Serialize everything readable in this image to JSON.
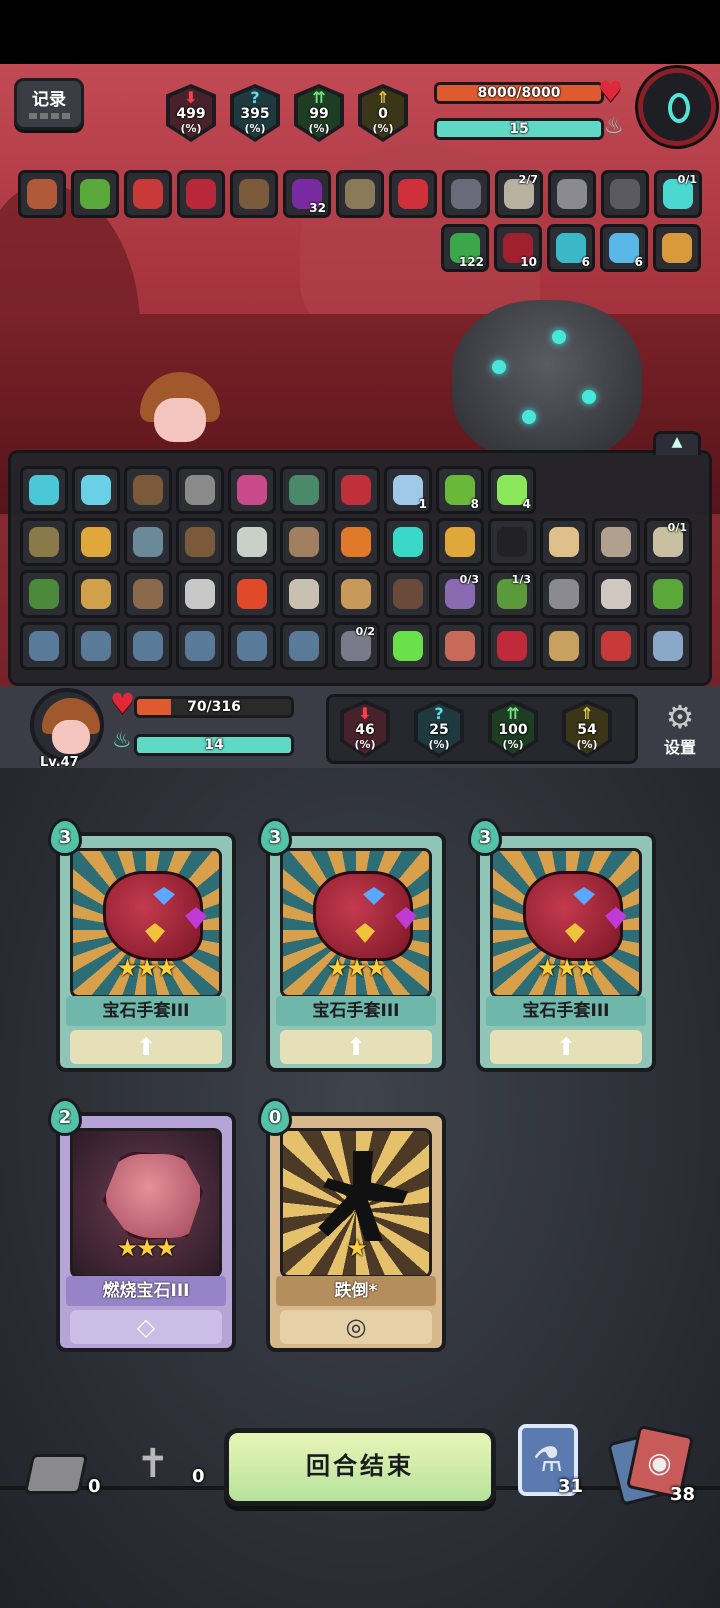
{
  "enemy": {
    "stats": [
      {
        "name": "attack",
        "value": "499",
        "unit": "(%)",
        "glyph": "⬇",
        "color": "red"
      },
      {
        "name": "mystery",
        "value": "395",
        "unit": "(%)",
        "glyph": "?",
        "color": "cyan"
      },
      {
        "name": "defense",
        "value": "99",
        "unit": "(%)",
        "glyph": "⇈",
        "color": "green"
      },
      {
        "name": "crit",
        "value": "0",
        "unit": "(%)",
        "glyph": "⇑",
        "color": "gold"
      }
    ],
    "hp_text": "8000/8000",
    "hp_fraction": 1.0,
    "energy_text": "15",
    "energy_fraction": 1.0,
    "relics_row1": [
      {
        "icon": "meat-icon",
        "count": "",
        "frac": "",
        "color": "#b05a3a"
      },
      {
        "icon": "green-slime-icon",
        "count": "",
        "frac": "",
        "color": "#5aa83a"
      },
      {
        "icon": "red-flute-icon",
        "count": "",
        "frac": "",
        "color": "#c83a3a"
      },
      {
        "icon": "boxing-glove-icon",
        "count": "",
        "frac": "",
        "color": "#b8283a"
      },
      {
        "icon": "owl-icon",
        "count": "",
        "frac": "",
        "color": "#7a5a3a"
      },
      {
        "icon": "attack-down-icon",
        "count": "32",
        "frac": "",
        "color": "#7a2aa0"
      },
      {
        "icon": "book-icon",
        "count": "",
        "frac": "",
        "color": "#8a7a5a"
      },
      {
        "icon": "red-bottle-icon",
        "count": "",
        "frac": "",
        "color": "#d0303a"
      },
      {
        "icon": "arrows-icon",
        "count": "",
        "frac": "",
        "color": "#6a6a7a"
      },
      {
        "icon": "pocket-watch-icon",
        "count": "",
        "frac": "2/7",
        "color": "#b8b0a0"
      },
      {
        "icon": "fan-icon",
        "count": "",
        "frac": "",
        "color": "#8a8a90"
      },
      {
        "icon": "claw-icon",
        "count": "",
        "frac": "",
        "color": "#5a5a60"
      },
      {
        "icon": "ring-icon",
        "count": "",
        "frac": "0/1",
        "color": "#4ad8d0"
      }
    ],
    "effects_row2": [
      {
        "icon": "poison-skull-icon",
        "count": "122",
        "color": "#3aa84a"
      },
      {
        "icon": "bleed-icon",
        "count": "10",
        "color": "#a02030"
      },
      {
        "icon": "target-icon",
        "count": "6",
        "color": "#3ab8c8"
      },
      {
        "icon": "freeze-icon",
        "count": "6",
        "color": "#5ab8e8"
      },
      {
        "icon": "horn-icon",
        "count": "",
        "color": "#d89a3a"
      }
    ]
  },
  "inventory": {
    "toggle_glyph": "▲",
    "rows": [
      [
        {
          "icon": "ice-crystal-icon",
          "count": "",
          "frac": "",
          "color": "#4ac8d8"
        },
        {
          "icon": "crystal-ball-icon",
          "count": "",
          "frac": "",
          "color": "#6ad0e8"
        },
        {
          "icon": "pouch-icon",
          "count": "",
          "frac": "",
          "color": "#7a5a3a"
        },
        {
          "icon": "trap-icon",
          "count": "",
          "frac": "",
          "color": "#8a8a8a"
        },
        {
          "icon": "egg-icon",
          "count": "",
          "frac": "",
          "color": "#c84a8a"
        },
        {
          "icon": "idol-icon",
          "count": "",
          "frac": "",
          "color": "#4a8a6a"
        },
        {
          "icon": "red-glove-icon",
          "count": "",
          "frac": "",
          "color": "#c0303a"
        },
        {
          "icon": "shield-icon",
          "count": "1",
          "frac": "",
          "color": "#a0c8e8"
        },
        {
          "icon": "green-blob-icon",
          "count": "8",
          "frac": "",
          "color": "#6ab83a"
        },
        {
          "icon": "green-beam-icon",
          "count": "4",
          "frac": "",
          "color": "#8ae85a"
        }
      ],
      [
        {
          "icon": "turtle-icon",
          "count": "",
          "frac": "",
          "color": "#8a7a4a"
        },
        {
          "icon": "golden-horn-icon",
          "count": "",
          "frac": "",
          "color": "#e0a83a"
        },
        {
          "icon": "goggles-icon",
          "count": "",
          "frac": "",
          "color": "#6a8a9a"
        },
        {
          "icon": "owl-icon",
          "count": "",
          "frac": "",
          "color": "#7a5a3a"
        },
        {
          "icon": "ghost-icon",
          "count": "",
          "frac": "",
          "color": "#c8d0c8"
        },
        {
          "icon": "gnome-icon",
          "count": "",
          "frac": "",
          "color": "#a08060"
        },
        {
          "icon": "bomb-icon",
          "count": "",
          "frac": "",
          "color": "#e07a2a"
        },
        {
          "icon": "teal-orb-icon",
          "count": "",
          "frac": "",
          "color": "#3ad8c8"
        },
        {
          "icon": "golden-horn-icon",
          "count": "",
          "frac": "",
          "color": "#e0a83a"
        },
        {
          "icon": "black-hat-icon",
          "count": "",
          "frac": "",
          "color": "#222226"
        },
        {
          "icon": "potion-icon",
          "count": "",
          "frac": "",
          "color": "#e0c08a"
        },
        {
          "icon": "viking-icon",
          "count": "",
          "frac": "",
          "color": "#b0a090"
        },
        {
          "icon": "magnifier-icon",
          "count": "",
          "frac": "0/1",
          "color": "#c8c0a0"
        }
      ],
      [
        {
          "icon": "fish-icon",
          "count": "",
          "frac": "",
          "color": "#4a8a3a"
        },
        {
          "icon": "broom-icon",
          "count": "",
          "frac": "",
          "color": "#d0a04a"
        },
        {
          "icon": "shell-icon",
          "count": "",
          "frac": "",
          "color": "#8a6a4a"
        },
        {
          "icon": "tea-pot-icon",
          "count": "",
          "frac": "",
          "color": "#c8c8c8"
        },
        {
          "icon": "apple-icon",
          "count": "",
          "frac": "",
          "color": "#e04a2a"
        },
        {
          "icon": "wings-icon",
          "count": "",
          "frac": "",
          "color": "#c8c0b0"
        },
        {
          "icon": "straw-hat-icon",
          "count": "",
          "frac": "",
          "color": "#c89a5a"
        },
        {
          "icon": "log-icon",
          "count": "",
          "frac": "",
          "color": "#6a4a3a"
        },
        {
          "icon": "spellbook-icon",
          "count": "",
          "frac": "0/3",
          "color": "#8a6ab0"
        },
        {
          "icon": "plant-icon",
          "count": "",
          "frac": "1/3",
          "color": "#5a9a3a"
        },
        {
          "icon": "grenade-icon",
          "count": "",
          "frac": "",
          "color": "#8a8a90"
        },
        {
          "icon": "teacup-icon",
          "count": "",
          "frac": "",
          "color": "#d0c8c0"
        },
        {
          "icon": "green-slime-icon",
          "count": "",
          "frac": "",
          "color": "#5aa83a"
        }
      ],
      [
        {
          "icon": "locked-slot-icon",
          "count": "",
          "frac": "",
          "color": "#5a7a9a"
        },
        {
          "icon": "locked-slot-icon",
          "count": "",
          "frac": "",
          "color": "#5a7a9a"
        },
        {
          "icon": "locked-slot-icon",
          "count": "",
          "frac": "",
          "color": "#5a7a9a"
        },
        {
          "icon": "locked-slot-icon",
          "count": "",
          "frac": "",
          "color": "#5a7a9a"
        },
        {
          "icon": "locked-slot-icon",
          "count": "",
          "frac": "",
          "color": "#5a7a9a"
        },
        {
          "icon": "locked-slot-icon",
          "count": "",
          "frac": "",
          "color": "#5a7a9a"
        },
        {
          "icon": "armor-icon",
          "count": "",
          "frac": "0/2",
          "color": "#7a7a8a"
        },
        {
          "icon": "green-vial-icon",
          "count": "",
          "frac": "",
          "color": "#6ae04a"
        },
        {
          "icon": "ham-icon",
          "count": "",
          "frac": "",
          "color": "#c86a5a"
        },
        {
          "icon": "red-gauntlet-icon",
          "count": "",
          "frac": "",
          "color": "#c02a3a"
        },
        {
          "icon": "hourglass-icon",
          "count": "",
          "frac": "",
          "color": "#c8a060"
        },
        {
          "icon": "red-flute-icon",
          "count": "",
          "frac": "",
          "color": "#c83a3a"
        },
        {
          "icon": "lamp-icon",
          "count": "",
          "frac": "",
          "color": "#8aa8c8"
        }
      ]
    ]
  },
  "player": {
    "level": "Lv.47",
    "hp_text": "70/316",
    "hp_fraction": 0.22,
    "energy_text": "14",
    "energy_fraction": 1.0,
    "stats": [
      {
        "name": "attack",
        "value": "46",
        "unit": "(%)",
        "glyph": "⬇",
        "color": "red"
      },
      {
        "name": "mystery",
        "value": "25",
        "unit": "(%)",
        "glyph": "?",
        "color": "cyan"
      },
      {
        "name": "defense",
        "value": "100",
        "unit": "(%)",
        "glyph": "⇈",
        "color": "green"
      },
      {
        "name": "crit",
        "value": "54",
        "unit": "(%)",
        "glyph": "⇑",
        "color": "gold"
      }
    ],
    "settings_label": "设置"
  },
  "hand": [
    {
      "cost": "3",
      "name": "宝石手套III",
      "stars": "★★★",
      "style": "blue",
      "foot": "⬆"
    },
    {
      "cost": "3",
      "name": "宝石手套III",
      "stars": "★★★",
      "style": "blue",
      "foot": "⬆"
    },
    {
      "cost": "3",
      "name": "宝石手套III",
      "stars": "★★★",
      "style": "blue",
      "foot": "⬆"
    },
    {
      "cost": "2",
      "name": "燃烧宝石III",
      "stars": "★★★",
      "style": "purple",
      "foot": "◇"
    },
    {
      "cost": "0",
      "name": "跌倒*",
      "stars": "★",
      "style": "orange",
      "foot": "◎"
    }
  ],
  "footer": {
    "record_label": "记录",
    "end_turn_label": "回合结束",
    "exhaust_count": "0",
    "grave_count": "0",
    "potion_count": "31",
    "deck_count": "38"
  }
}
